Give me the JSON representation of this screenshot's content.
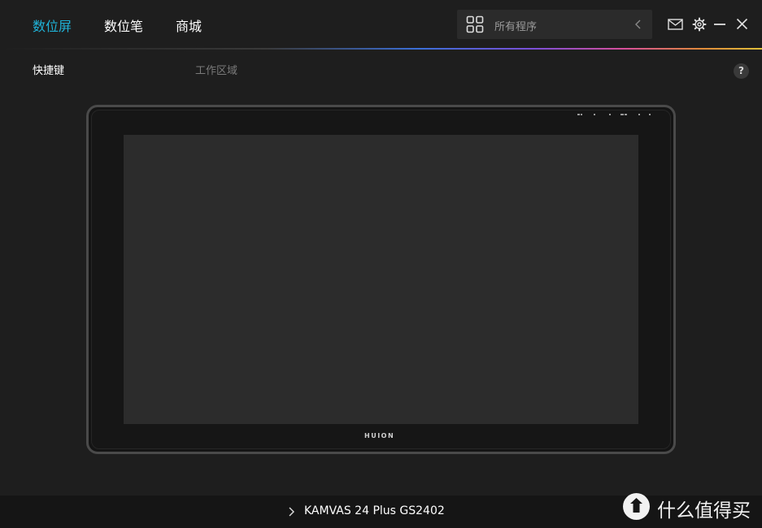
{
  "tabs": [
    {
      "label": "数位屏",
      "active": true
    },
    {
      "label": "数位笔",
      "active": false
    },
    {
      "label": "商城",
      "active": false
    }
  ],
  "app_selector": {
    "label": "所有程序",
    "icon": "grid-icon",
    "toggle_icon": "chevron-left-icon"
  },
  "window_controls": [
    "mail-icon",
    "gear-icon",
    "minimize-icon",
    "close-icon"
  ],
  "subnav": [
    {
      "label": "快捷键",
      "active": true
    },
    {
      "label": "工作区域",
      "active": false
    }
  ],
  "help": {
    "label": "?"
  },
  "device": {
    "brand": "HUION"
  },
  "footer": {
    "device_name": "KAMVAS 24 Plus GS2402",
    "icon": "chevron-right-icon"
  },
  "watermark": {
    "text": "什么值得买"
  },
  "colors": {
    "accent": "#1fb3d8",
    "background": "#1e1e1e",
    "screen": "#2c2c2c",
    "footer": "#151515"
  }
}
